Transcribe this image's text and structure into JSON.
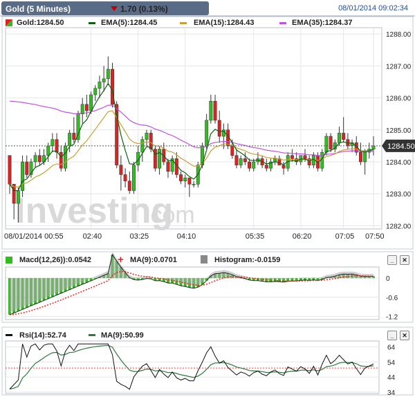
{
  "header": {
    "title": "Gold (5 Minutes)",
    "change": "1.70 (0.13%)",
    "datetime": "08/01/2014 09:02:34"
  },
  "legend": {
    "price": "Gold:1284.50",
    "ema5": "EMA(5):1284.45",
    "ema15": "EMA(15):1284.43",
    "ema35": "EMA(35):1284.37",
    "macd": "Macd(12,26)):0.0542",
    "macd_ma": "MA(9):0.0701",
    "histogram": "Histogram:-0.0159",
    "rsi": "Rsi(14):52.74",
    "rsi_ma": "MA(9):50.99"
  },
  "watermark": {
    "brand": "Investing",
    "suffix": ".com"
  },
  "price_badge": "1284.50",
  "colors": {
    "up": "#33bb22",
    "down": "#dd2222",
    "ema5": "#106010",
    "ema15": "#c8a030",
    "ema35": "#c050e0",
    "macd": "#222222",
    "signal": "#ee2222",
    "hist": "#666666",
    "rsi": "#111111",
    "rsi_ma": "#2a7a3a",
    "header": "#5a6b86"
  },
  "chart_data": [
    {
      "type": "candlestick",
      "title": "Gold (5 Minutes)",
      "x_ticks": [
        "08/01/2014 00:55",
        "02:40",
        "03:25",
        "04:10",
        "05:35",
        "06:20",
        "07:05",
        "07:50"
      ],
      "y_ticks": [
        1282.0,
        1283.0,
        1284.0,
        1285.0,
        1286.0,
        1287.0,
        1288.0
      ],
      "ylim": [
        1281.9,
        1288.2
      ],
      "last_price": 1284.5,
      "candles": [
        [
          1284.2,
          1284.0,
          1283.0,
          1283.3
        ],
        [
          1283.3,
          1283.3,
          1282.2,
          1282.7
        ],
        [
          1282.7,
          1283.2,
          1282.1,
          1283.1
        ],
        [
          1283.1,
          1284.2,
          1282.9,
          1284.0
        ],
        [
          1284.0,
          1284.2,
          1283.5,
          1283.6
        ],
        [
          1283.6,
          1284.1,
          1283.5,
          1284.0
        ],
        [
          1284.0,
          1284.3,
          1283.8,
          1284.2
        ],
        [
          1284.2,
          1284.4,
          1283.9,
          1284.0
        ],
        [
          1284.0,
          1284.4,
          1283.9,
          1284.2
        ],
        [
          1284.2,
          1284.6,
          1284.0,
          1284.5
        ],
        [
          1284.5,
          1284.9,
          1284.3,
          1284.7
        ],
        [
          1284.7,
          1284.9,
          1284.1,
          1284.3
        ],
        [
          1284.3,
          1284.5,
          1283.7,
          1283.8
        ],
        [
          1283.8,
          1284.6,
          1283.7,
          1284.5
        ],
        [
          1284.5,
          1285.0,
          1284.3,
          1284.9
        ],
        [
          1284.9,
          1285.4,
          1284.6,
          1284.7
        ],
        [
          1284.7,
          1285.6,
          1284.6,
          1285.5
        ],
        [
          1285.5,
          1286.0,
          1285.2,
          1285.8
        ],
        [
          1285.8,
          1286.1,
          1285.4,
          1285.6
        ],
        [
          1285.6,
          1286.2,
          1285.5,
          1286.1
        ],
        [
          1286.1,
          1286.4,
          1285.9,
          1286.3
        ],
        [
          1286.3,
          1286.7,
          1286.0,
          1286.5
        ],
        [
          1286.5,
          1287.0,
          1286.2,
          1286.6
        ],
        [
          1286.6,
          1287.3,
          1286.4,
          1286.9
        ],
        [
          1286.9,
          1287.1,
          1285.7,
          1285.8
        ],
        [
          1285.8,
          1285.9,
          1283.8,
          1283.9
        ],
        [
          1283.9,
          1284.2,
          1283.1,
          1283.6
        ],
        [
          1283.6,
          1283.8,
          1283.2,
          1283.4
        ],
        [
          1283.4,
          1283.7,
          1283.0,
          1283.1
        ],
        [
          1283.1,
          1284.0,
          1283.0,
          1283.9
        ],
        [
          1283.9,
          1284.5,
          1283.7,
          1284.3
        ],
        [
          1284.3,
          1284.8,
          1284.0,
          1284.7
        ],
        [
          1284.7,
          1285.0,
          1284.5,
          1284.9
        ],
        [
          1284.9,
          1285.0,
          1284.3,
          1284.4
        ],
        [
          1284.4,
          1284.5,
          1283.7,
          1283.8
        ],
        [
          1283.8,
          1284.5,
          1283.6,
          1284.4
        ],
        [
          1284.4,
          1284.6,
          1283.9,
          1284.0
        ],
        [
          1284.0,
          1284.1,
          1283.5,
          1283.7
        ],
        [
          1283.7,
          1284.2,
          1283.6,
          1284.1
        ],
        [
          1284.1,
          1284.3,
          1283.5,
          1283.6
        ],
        [
          1283.6,
          1283.7,
          1283.3,
          1283.4
        ],
        [
          1283.4,
          1283.6,
          1283.2,
          1283.5
        ],
        [
          1283.5,
          1283.5,
          1282.9,
          1283.3
        ],
        [
          1283.3,
          1283.4,
          1283.2,
          1283.3
        ],
        [
          1283.3,
          1284.0,
          1283.2,
          1283.9
        ],
        [
          1283.9,
          1284.6,
          1283.8,
          1284.5
        ],
        [
          1284.5,
          1285.5,
          1284.4,
          1285.3
        ],
        [
          1285.3,
          1286.1,
          1285.2,
          1285.9
        ],
        [
          1285.9,
          1286.1,
          1285.2,
          1285.3
        ],
        [
          1285.3,
          1285.6,
          1284.6,
          1284.8
        ],
        [
          1284.8,
          1285.2,
          1284.4,
          1285.0
        ],
        [
          1285.0,
          1285.2,
          1284.4,
          1284.5
        ],
        [
          1284.5,
          1284.7,
          1284.1,
          1284.2
        ],
        [
          1284.2,
          1284.4,
          1283.8,
          1283.9
        ],
        [
          1283.9,
          1284.2,
          1283.8,
          1284.1
        ],
        [
          1284.1,
          1284.3,
          1283.9,
          1284.0
        ],
        [
          1284.0,
          1284.1,
          1283.7,
          1283.8
        ],
        [
          1283.8,
          1284.1,
          1283.7,
          1284.0
        ],
        [
          1284.0,
          1284.3,
          1283.9,
          1284.1
        ],
        [
          1284.1,
          1284.2,
          1283.8,
          1283.9
        ],
        [
          1283.9,
          1284.1,
          1283.7,
          1283.8
        ],
        [
          1283.8,
          1284.1,
          1283.7,
          1284.0
        ],
        [
          1284.0,
          1284.2,
          1283.9,
          1284.1
        ],
        [
          1284.1,
          1284.2,
          1283.9,
          1283.9
        ],
        [
          1283.9,
          1284.0,
          1283.6,
          1283.8
        ],
        [
          1283.8,
          1284.3,
          1283.7,
          1284.2
        ],
        [
          1284.2,
          1284.4,
          1284.0,
          1284.1
        ],
        [
          1284.1,
          1284.3,
          1283.9,
          1284.0
        ],
        [
          1284.0,
          1284.2,
          1283.9,
          1284.2
        ],
        [
          1284.2,
          1284.4,
          1284.0,
          1284.1
        ],
        [
          1284.1,
          1284.2,
          1283.8,
          1283.9
        ],
        [
          1283.9,
          1284.3,
          1283.8,
          1284.2
        ],
        [
          1284.2,
          1284.3,
          1283.7,
          1283.8
        ],
        [
          1283.8,
          1284.4,
          1283.7,
          1284.3
        ],
        [
          1284.3,
          1284.9,
          1284.2,
          1284.8
        ],
        [
          1284.8,
          1284.9,
          1284.3,
          1284.4
        ],
        [
          1284.4,
          1284.7,
          1284.3,
          1284.6
        ],
        [
          1284.6,
          1285.1,
          1284.5,
          1284.9
        ],
        [
          1284.9,
          1285.4,
          1284.6,
          1284.7
        ],
        [
          1284.7,
          1284.9,
          1284.4,
          1284.5
        ],
        [
          1284.5,
          1284.7,
          1284.3,
          1284.6
        ],
        [
          1284.6,
          1284.8,
          1284.2,
          1284.3
        ],
        [
          1284.3,
          1284.6,
          1283.9,
          1284.0
        ],
        [
          1284.0,
          1284.4,
          1283.6,
          1284.3
        ],
        [
          1284.3,
          1284.6,
          1284.1,
          1284.4
        ],
        [
          1284.4,
          1284.8,
          1284.2,
          1284.5
        ]
      ]
    },
    {
      "type": "line",
      "series_names": [
        "Macd(12,26))",
        "MA(9)",
        "Histogram"
      ],
      "y_ticks": [
        0,
        -0.6,
        -1.2
      ],
      "ylim": [
        -1.3,
        0.35
      ]
    },
    {
      "type": "line",
      "series_names": [
        "Rsi(14)",
        "MA(9)"
      ],
      "y_ticks": [
        64,
        54,
        44,
        34
      ],
      "ylim": [
        33,
        68
      ],
      "reference_level": 50
    }
  ]
}
